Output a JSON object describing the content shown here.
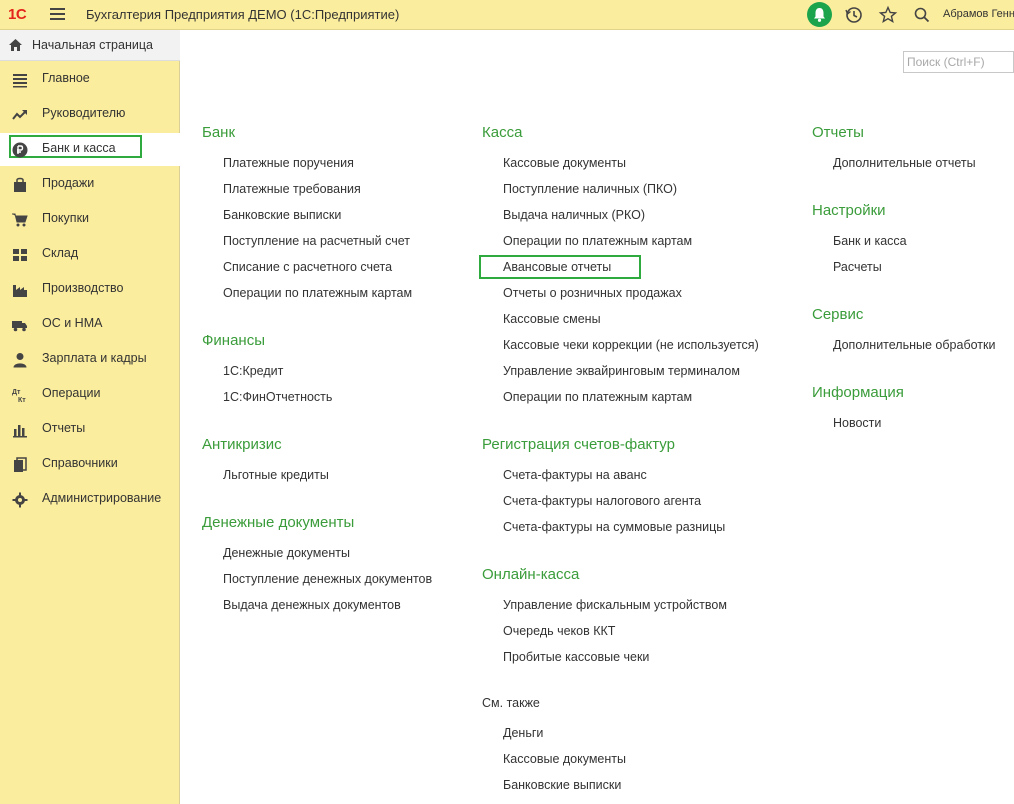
{
  "titlebar": {
    "logo": "1С",
    "app_title": "Бухгалтерия Предприятия ДЕМО  (1С:Предприятие)",
    "username": "Абрамов Генн"
  },
  "sidebar": {
    "home_label": "Начальная страница",
    "items": [
      {
        "label": "Главное",
        "icon": "list-icon"
      },
      {
        "label": "Руководителю",
        "icon": "trend-icon"
      },
      {
        "label": "Банк и касса",
        "icon": "ruble-icon"
      },
      {
        "label": "Продажи",
        "icon": "bag-icon"
      },
      {
        "label": "Покупки",
        "icon": "cart-icon"
      },
      {
        "label": "Склад",
        "icon": "warehouse-icon"
      },
      {
        "label": "Производство",
        "icon": "factory-icon"
      },
      {
        "label": "ОС и НМА",
        "icon": "truck-icon"
      },
      {
        "label": "Зарплата и кадры",
        "icon": "person-icon"
      },
      {
        "label": "Операции",
        "icon": "dt-kt-icon"
      },
      {
        "label": "Отчеты",
        "icon": "bar-chart-icon"
      },
      {
        "label": "Справочники",
        "icon": "books-icon"
      },
      {
        "label": "Администрирование",
        "icon": "gear-icon"
      }
    ],
    "active_index": 2
  },
  "search": {
    "placeholder": "Поиск (Ctrl+F)"
  },
  "sections": {
    "bank": {
      "title": "Банк",
      "links": [
        "Платежные поручения",
        "Платежные требования",
        "Банковские выписки",
        "Поступление на расчетный счет",
        "Списание с расчетного счета",
        "Операции по платежным картам"
      ]
    },
    "finance": {
      "title": "Финансы",
      "links": [
        "1С:Кредит",
        "1С:ФинОтчетность"
      ]
    },
    "anticrisis": {
      "title": "Антикризис",
      "links": [
        "Льготные кредиты"
      ]
    },
    "money_docs": {
      "title": "Денежные документы",
      "links": [
        "Денежные документы",
        "Поступление денежных документов",
        "Выдача денежных документов"
      ]
    },
    "cash": {
      "title": "Касса",
      "links": [
        "Кассовые документы",
        "Поступление наличных (ПКО)",
        "Выдача наличных (РКО)",
        "Операции по платежным картам",
        "Авансовые отчеты",
        "Отчеты о розничных продажах",
        "Кассовые смены",
        "Кассовые чеки коррекции (не используется)",
        "Управление эквайринговым терминалом",
        "Операции по платежным картам"
      ]
    },
    "invoices": {
      "title": "Регистрация счетов-фактур",
      "links": [
        "Счета-фактуры на аванс",
        "Счета-фактуры налогового агента",
        "Счета-фактуры на суммовые разницы"
      ]
    },
    "online_cash": {
      "title": "Онлайн-касса",
      "links": [
        "Управление фискальным устройством",
        "Очередь чеков ККТ",
        "Пробитые кассовые чеки"
      ]
    },
    "see_also": {
      "title": "См. также",
      "links": [
        "Деньги",
        "Кассовые документы",
        "Банковские выписки"
      ]
    },
    "reports": {
      "title": "Отчеты",
      "links": [
        "Дополнительные отчеты"
      ]
    },
    "settings": {
      "title": "Настройки",
      "links": [
        "Банк и касса",
        "Расчеты"
      ]
    },
    "service": {
      "title": "Сервис",
      "links": [
        "Дополнительные обработки"
      ]
    },
    "info": {
      "title": "Информация",
      "links": [
        "Новости"
      ]
    }
  },
  "colors": {
    "sidebar_bg": "#fbed9e",
    "section_title": "#3a9c3a",
    "highlight_frame": "#2eaa3f",
    "logo_red": "#e4261c"
  }
}
